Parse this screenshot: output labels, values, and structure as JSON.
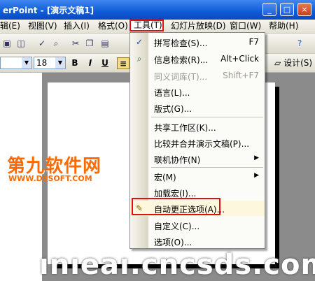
{
  "window": {
    "title": "erPoint - [演示文稿1]",
    "min": "_",
    "max": "□",
    "close": "×"
  },
  "menubar": {
    "items": [
      "辑(E)",
      "视图(V)",
      "插入(I)",
      "格式(O)",
      "工具(T)",
      "幻灯片放映(D)",
      "窗口(W)",
      "帮助(H)"
    ]
  },
  "toolbar": {
    "font_size": "18",
    "bold": "B",
    "italic": "I",
    "underline": "U",
    "design": "设计(S)"
  },
  "tools_menu": {
    "items": [
      {
        "label": "拼写检查(S)...",
        "shortcut": "F7",
        "icon": "spellcheck-icon"
      },
      {
        "label": "信息检索(R)...",
        "shortcut": "Alt+Click",
        "icon": "research-icon"
      },
      {
        "label": "同义词库(T)...",
        "shortcut": "Shift+F7",
        "disabled": true
      },
      {
        "label": "语言(L)..."
      },
      {
        "label": "版式(G)..."
      },
      {
        "label": "共享工作区(K)..."
      },
      {
        "label": "比较并合并演示文稿(P)..."
      },
      {
        "label": "联机协作(N)",
        "submenu": true
      },
      {
        "label": "宏(M)",
        "submenu": true
      },
      {
        "label": "加载宏(I)..."
      },
      {
        "label": "自动更正选项(A)...",
        "icon": "autocorrect-icon"
      },
      {
        "label": "自定义(C)..."
      },
      {
        "label": "选项(O)..."
      }
    ]
  },
  "watermarks": {
    "cn": "第九软件网",
    "url": "WWW.D9SOFT.COM",
    "bottom": "ınıeaı.cncsds.com"
  }
}
